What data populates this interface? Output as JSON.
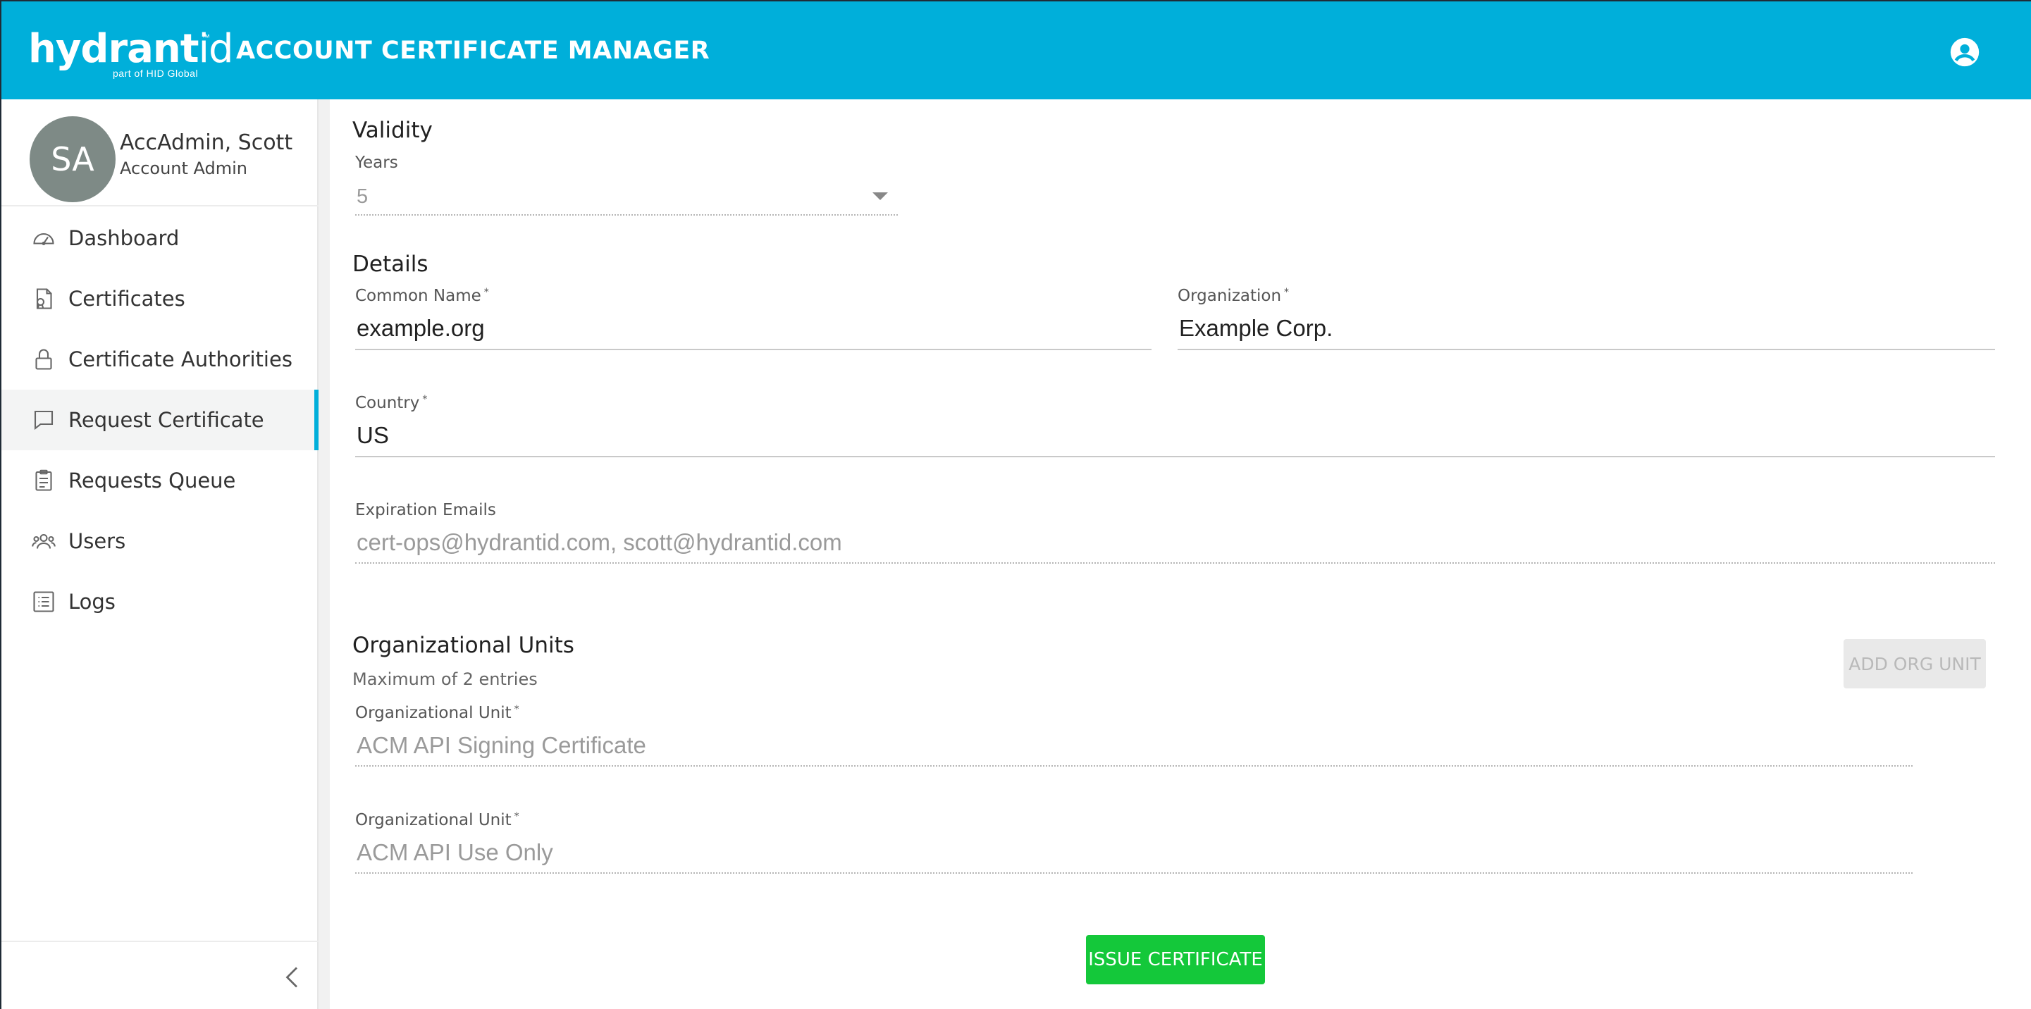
{
  "header": {
    "logo_text_bold": "hydrant",
    "logo_text_thin": "id",
    "logo_tm": "™",
    "logo_sub": "part of HID Global",
    "title": "ACCOUNT CERTIFICATE MANAGER",
    "account_icon": "account-circle-icon",
    "bg_color": "#00afda"
  },
  "sidebar": {
    "profile": {
      "initials": "SA",
      "name": "AccAdmin, Scott",
      "role": "Account Admin"
    },
    "items": [
      {
        "label": "Dashboard",
        "icon": "dashboard-icon"
      },
      {
        "label": "Certificates",
        "icon": "certificate-icon"
      },
      {
        "label": "Certificate Authorities",
        "icon": "lock-icon"
      },
      {
        "label": "Request Certificate",
        "icon": "chat-icon",
        "active": true
      },
      {
        "label": "Requests Queue",
        "icon": "clipboard-icon"
      },
      {
        "label": "Users",
        "icon": "users-icon"
      },
      {
        "label": "Logs",
        "icon": "list-icon"
      }
    ],
    "collapse_icon": "chevron-left-icon",
    "active_color": "#00afda"
  },
  "form": {
    "validity": {
      "title": "Validity",
      "years_label": "Years",
      "years_value": "5"
    },
    "details": {
      "title": "Details",
      "common_name_label": "Common Name",
      "common_name_value": "example.org",
      "organization_label": "Organization",
      "organization_value": "Example Corp.",
      "country_label": "Country",
      "country_value": "US",
      "expiration_emails_label": "Expiration Emails",
      "expiration_emails_placeholder": "cert-ops@hydrantid.com, scott@hydrantid.com",
      "required_mark": "*"
    },
    "org_units": {
      "title": "Organizational Units",
      "hint": "Maximum of 2 entries",
      "add_button": "ADD ORG UNIT",
      "units": [
        {
          "label": "Organizational Unit",
          "value": "ACM API Signing Certificate"
        },
        {
          "label": "Organizational Unit",
          "value": "ACM API Use Only"
        }
      ]
    },
    "issue_button": "ISSUE CERTIFICATE",
    "issue_color": "#14c83a"
  }
}
